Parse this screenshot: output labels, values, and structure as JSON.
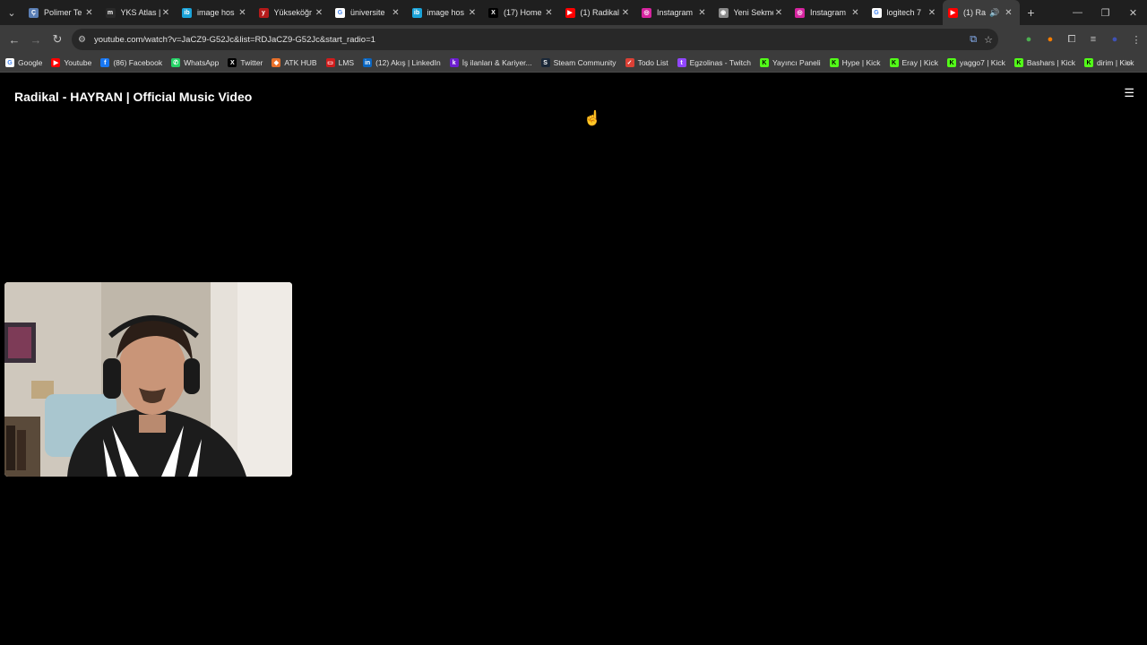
{
  "tabs": [
    {
      "title": "Polimer Te",
      "color": "#5b7fb5",
      "glyph": "Ç"
    },
    {
      "title": "YKS Atlas |",
      "color": "#2a2a2a",
      "glyph": "m"
    },
    {
      "title": "image hos",
      "color": "#1aa3d9",
      "glyph": "ib"
    },
    {
      "title": "Yükseköğr",
      "color": "#b51a1a",
      "glyph": "y"
    },
    {
      "title": "üniversite",
      "color": "#ffffff",
      "glyph": "G"
    },
    {
      "title": "image hos",
      "color": "#1aa3d9",
      "glyph": "ib"
    },
    {
      "title": "(17) Home",
      "color": "#000000",
      "glyph": "X"
    },
    {
      "title": "(1) Radikal",
      "color": "#ff0000",
      "glyph": "▶"
    },
    {
      "title": "Instagram",
      "color": "#d6249f",
      "glyph": "◎"
    },
    {
      "title": "Yeni Sekme",
      "color": "#8a8a8a",
      "glyph": "◉"
    },
    {
      "title": "Instagram",
      "color": "#d6249f",
      "glyph": "◎"
    },
    {
      "title": "logitech 7",
      "color": "#ffffff",
      "glyph": "G"
    },
    {
      "title": "(1) Ra",
      "color": "#ff0000",
      "glyph": "▶",
      "active": true
    }
  ],
  "address": {
    "url": "youtube.com/watch?v=JaCZ9-G52Jc&list=RDJaCZ9-G52Jc&start_radio=1"
  },
  "bookmarks": [
    {
      "label": "Google",
      "color": "#ffffff",
      "glyph": "G"
    },
    {
      "label": "Youtube",
      "color": "#ff0000",
      "glyph": "▶"
    },
    {
      "label": "(86) Facebook",
      "color": "#1877f2",
      "glyph": "f"
    },
    {
      "label": "WhatsApp",
      "color": "#25d366",
      "glyph": "✆"
    },
    {
      "label": "Twitter",
      "color": "#000000",
      "glyph": "X"
    },
    {
      "label": "ATK HUB",
      "color": "#e8702a",
      "glyph": "◆"
    },
    {
      "label": "LMS",
      "color": "#d01c1c",
      "glyph": "▭"
    },
    {
      "label": "(12) Akış | LinkedIn",
      "color": "#0a66c2",
      "glyph": "in"
    },
    {
      "label": "İş ilanları & Kariyer...",
      "color": "#6c1dcf",
      "glyph": "k"
    },
    {
      "label": "Steam Community",
      "color": "#1b2838",
      "glyph": "S"
    },
    {
      "label": "Todo List",
      "color": "#db4035",
      "glyph": "✓"
    },
    {
      "label": "Egzolinas - Twitch",
      "color": "#9146ff",
      "glyph": "t"
    },
    {
      "label": "Yayıncı Paneli",
      "color": "#53fc18",
      "glyph": "K"
    },
    {
      "label": "Hype | Kick",
      "color": "#53fc18",
      "glyph": "K"
    },
    {
      "label": "Eray | Kick",
      "color": "#53fc18",
      "glyph": "K"
    },
    {
      "label": "yaggo7 | Kick",
      "color": "#53fc18",
      "glyph": "K"
    },
    {
      "label": "Bashars | Kick",
      "color": "#53fc18",
      "glyph": "K"
    },
    {
      "label": "dirim | Kick",
      "color": "#53fc18",
      "glyph": "K"
    }
  ],
  "video": {
    "title": "Radikal - HAYRAN | Official Music Video"
  },
  "icons": {
    "tab_menu": "chevron-down-icon",
    "back": "back-arrow-icon",
    "forward": "forward-arrow-icon",
    "reload": "reload-icon",
    "playlist": "playlist-icon"
  }
}
